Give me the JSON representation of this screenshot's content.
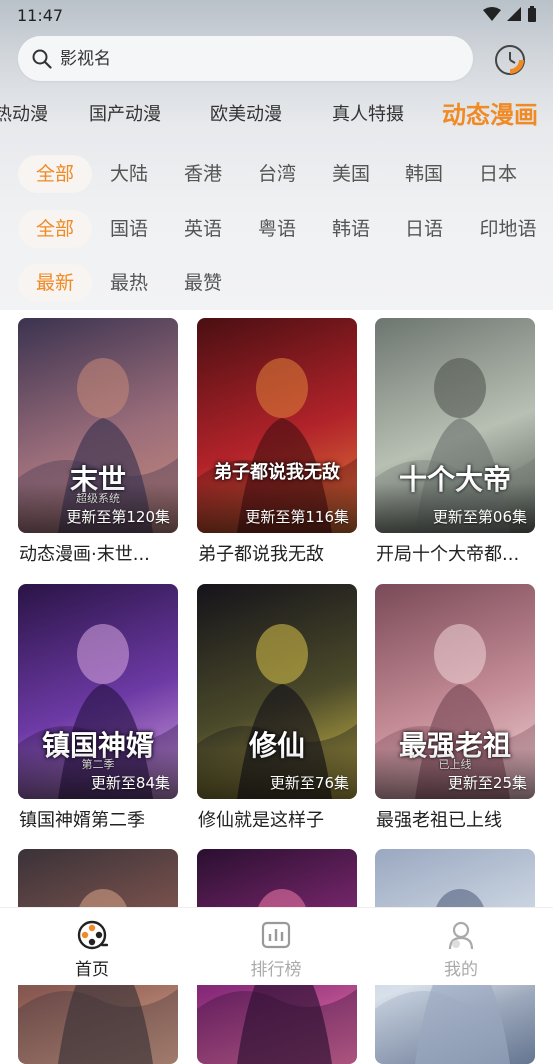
{
  "status_bar": {
    "time": "11:47"
  },
  "search": {
    "placeholder": "影视名"
  },
  "categories": [
    {
      "label": "热动漫",
      "active": false
    },
    {
      "label": "国产动漫",
      "active": false
    },
    {
      "label": "欧美动漫",
      "active": false
    },
    {
      "label": "真人特摄",
      "active": false
    },
    {
      "label": "动态漫画",
      "active": true
    }
  ],
  "filters": {
    "region": [
      "全部",
      "大陆",
      "香港",
      "台湾",
      "美国",
      "韩国",
      "日本"
    ],
    "language": [
      "全部",
      "国语",
      "英语",
      "粤语",
      "韩语",
      "日语",
      "印地语"
    ],
    "sort": [
      "最新",
      "最热",
      "最赞"
    ]
  },
  "items": [
    {
      "title": "动态漫画·末世...",
      "episode": "更新至第120集",
      "cover_text": "末世",
      "cover_sub": "超级系统",
      "palette": [
        "#3b3350",
        "#9a6d7a",
        "#c98a79"
      ]
    },
    {
      "title": "弟子都说我无敌",
      "episode": "更新至第116集",
      "cover_text": "弟子都说我无敌",
      "cover_sub": "",
      "palette": [
        "#4a0f12",
        "#b2232a",
        "#e2833a"
      ]
    },
    {
      "title": "开局十个大帝都...",
      "episode": "更新至第06集",
      "cover_text": "十个大帝",
      "cover_sub": "",
      "palette": [
        "#6d7570",
        "#b8c0b4",
        "#4a5049"
      ]
    },
    {
      "title": "镇国神婿第二季",
      "episode": "更新至84集",
      "cover_text": "镇国神婿",
      "cover_sub": "第二季",
      "palette": [
        "#2a1446",
        "#6d3aa5",
        "#d9a7e0"
      ]
    },
    {
      "title": "修仙就是这样子",
      "episode": "更新至76集",
      "cover_text": "修仙",
      "cover_sub": "",
      "palette": [
        "#15131a",
        "#4b4a2a",
        "#d8c24a"
      ]
    },
    {
      "title": "最强老祖已上线",
      "episode": "更新至25集",
      "cover_text": "最强老祖",
      "cover_sub": "已上线",
      "palette": [
        "#7a4a58",
        "#c48c96",
        "#f0d6d8"
      ]
    },
    {
      "title": "",
      "episode": "",
      "cover_text": "",
      "cover_sub": "",
      "palette": [
        "#3a3238",
        "#8a5a52",
        "#d9a488"
      ]
    },
    {
      "title": "",
      "episode": "",
      "cover_text": "",
      "cover_sub": "",
      "palette": [
        "#2a0f30",
        "#8a2c7a",
        "#f07aa8"
      ]
    },
    {
      "title": "",
      "episode": "",
      "cover_text": "",
      "cover_sub": "",
      "palette": [
        "#9aa8c0",
        "#d8e0ea",
        "#4a5a78"
      ]
    }
  ],
  "bottom_nav": [
    {
      "label": "首页",
      "icon": "film-reel-icon",
      "active": true
    },
    {
      "label": "排行榜",
      "icon": "bar-chart-icon",
      "active": false
    },
    {
      "label": "我的",
      "icon": "user-icon",
      "active": false
    }
  ],
  "colors": {
    "accent": "#f08a24",
    "chip_bg": "#f7f4f1"
  }
}
